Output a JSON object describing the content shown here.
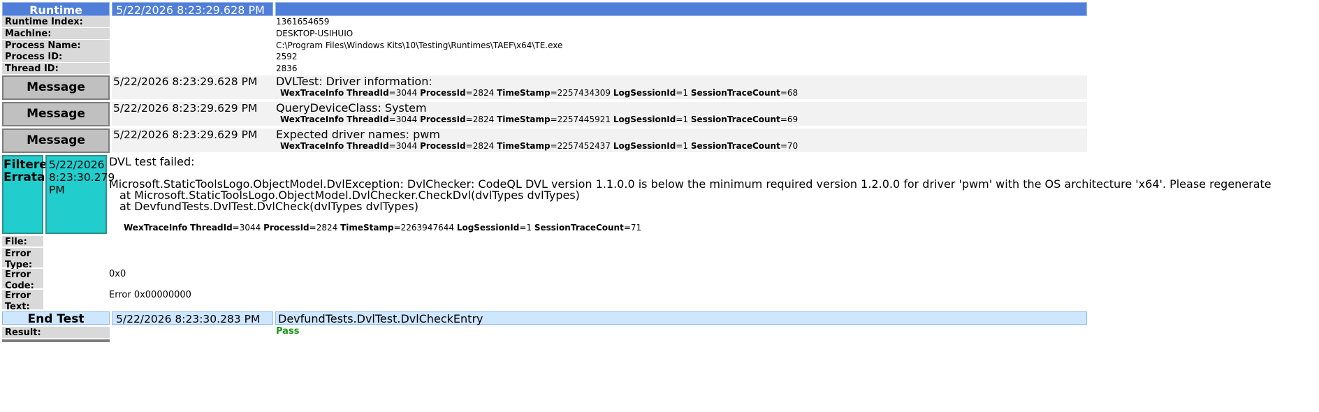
{
  "runtime": {
    "label": "Runtime",
    "timestamp": "5/22/2026 8:23:29.628 PM",
    "fields": [
      {
        "label": "Runtime Index:",
        "value": "1361654659"
      },
      {
        "label": "Machine:",
        "value": "DESKTOP-USIHUIO"
      },
      {
        "label": "Process Name:",
        "value": "C:\\Program Files\\Windows Kits\\10\\Testing\\Runtimes\\TAEF\\x64\\TE.exe"
      },
      {
        "label": "Process ID:",
        "value": "2592"
      },
      {
        "label": "Thread ID:",
        "value": "2836"
      }
    ]
  },
  "wex_keys": {
    "prefix": "WexTraceInfo",
    "thread": "ThreadId",
    "process": "ProcessId",
    "timestamp": "TimeStamp",
    "session": "LogSessionId",
    "count": "SessionTraceCount"
  },
  "messages": [
    {
      "label": "Message",
      "timestamp": "5/22/2026 8:23:29.628 PM",
      "text": "DVLTest: Driver information:",
      "trace": {
        "thread": "=3044",
        "process": "=2824",
        "timestamp": "=2257434309",
        "session": "=1",
        "count": "=68"
      }
    },
    {
      "label": "Message",
      "timestamp": "5/22/2026 8:23:29.629 PM",
      "text": "QueryDeviceClass: System",
      "trace": {
        "thread": "=3044",
        "process": "=2824",
        "timestamp": "=2257445921",
        "session": "=1",
        "count": "=69"
      }
    },
    {
      "label": "Message",
      "timestamp": "5/22/2026 8:23:29.629 PM",
      "text": "Expected driver names: pwm",
      "trace": {
        "thread": "=3044",
        "process": "=2824",
        "timestamp": "=2257452437",
        "session": "=1",
        "count": "=70"
      }
    }
  ],
  "errata": {
    "label": "Filtered Errata",
    "timestamp": "5/22/2026 8:23:30.279 PM",
    "title": "DVL test failed:",
    "exception": "Microsoft.StaticToolsLogo.ObjectModel.DvlException: DvlChecker: CodeQL DVL version 1.1.0.0 is below the minimum required version 1.2.0.0 for driver 'pwm' with the OS architecture 'x64'. Please regenerate",
    "stack": [
      "at Microsoft.StaticToolsLogo.ObjectModel.DvlChecker.CheckDvl(dvlTypes dvlTypes)",
      "at DevfundTests.DvlTest.DvlCheck(dvlTypes dvlTypes)"
    ],
    "trace": {
      "thread": "=3044",
      "process": "=2824",
      "timestamp": "=2263947644",
      "session": "=1",
      "count": "=71"
    },
    "fields": [
      {
        "label": "File:",
        "value": ""
      },
      {
        "label": "Error Type:",
        "value": ""
      },
      {
        "label": "Error Code:",
        "value": "0x0"
      },
      {
        "label": "Error Text:",
        "value": "Error 0x00000000"
      }
    ]
  },
  "end_test": {
    "label": "End Test",
    "timestamp": "5/22/2026 8:23:30.283 PM",
    "name": "DevfundTests.DvlTest.DvlCheckEntry",
    "result_label": "Result:",
    "result": "Pass"
  },
  "colors": {
    "header_bg": "#4f7fd9",
    "message_bg": "#c0c0c0",
    "errata_bg": "#22cdcd",
    "end_test_bg": "#cfe6ff",
    "pass_text": "#1a9a1a"
  }
}
